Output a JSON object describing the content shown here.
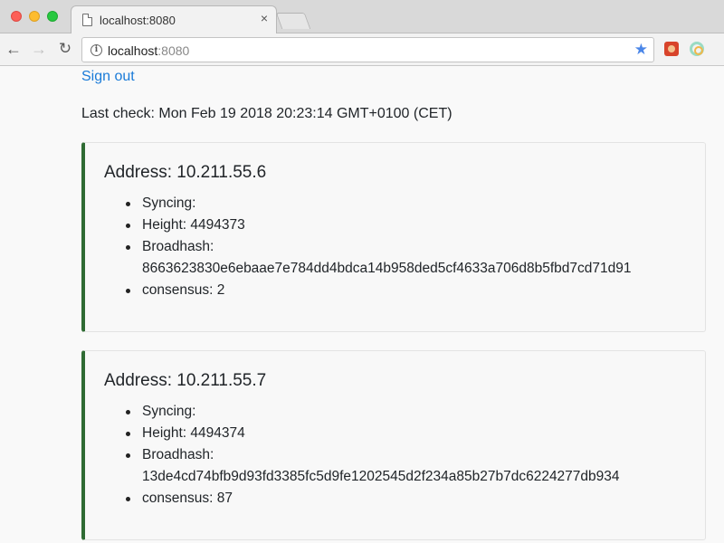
{
  "browser": {
    "tab_title": "localhost:8080",
    "tab_close": "×",
    "url_host": "localhost",
    "url_port": ":8080"
  },
  "page": {
    "sign_out": "Sign out",
    "last_check": "Last check: Mon Feb 19 2018 20:23:14 GMT+0100 (CET)"
  },
  "nodes": [
    {
      "address": "Address: 10.211.55.6",
      "syncing": "Syncing:",
      "height": "Height: 4494373",
      "broadhash_label": "Broadhash:",
      "broadhash": "8663623830e6ebaae7e784dd4bdca14b958ded5cf4633a706d8b5fbd7cd71d91",
      "consensus": "consensus: 2"
    },
    {
      "address": "Address: 10.211.55.7",
      "syncing": "Syncing:",
      "height": "Height: 4494374",
      "broadhash_label": "Broadhash:",
      "broadhash": "13de4cd74bfb9d93fd3385fc5d9fe1202545d2f234a85b27b7dc6224277db934",
      "consensus": "consensus: 87"
    }
  ],
  "colors": {
    "card_accent": "#2f6b33",
    "link": "#1a7bd8"
  }
}
